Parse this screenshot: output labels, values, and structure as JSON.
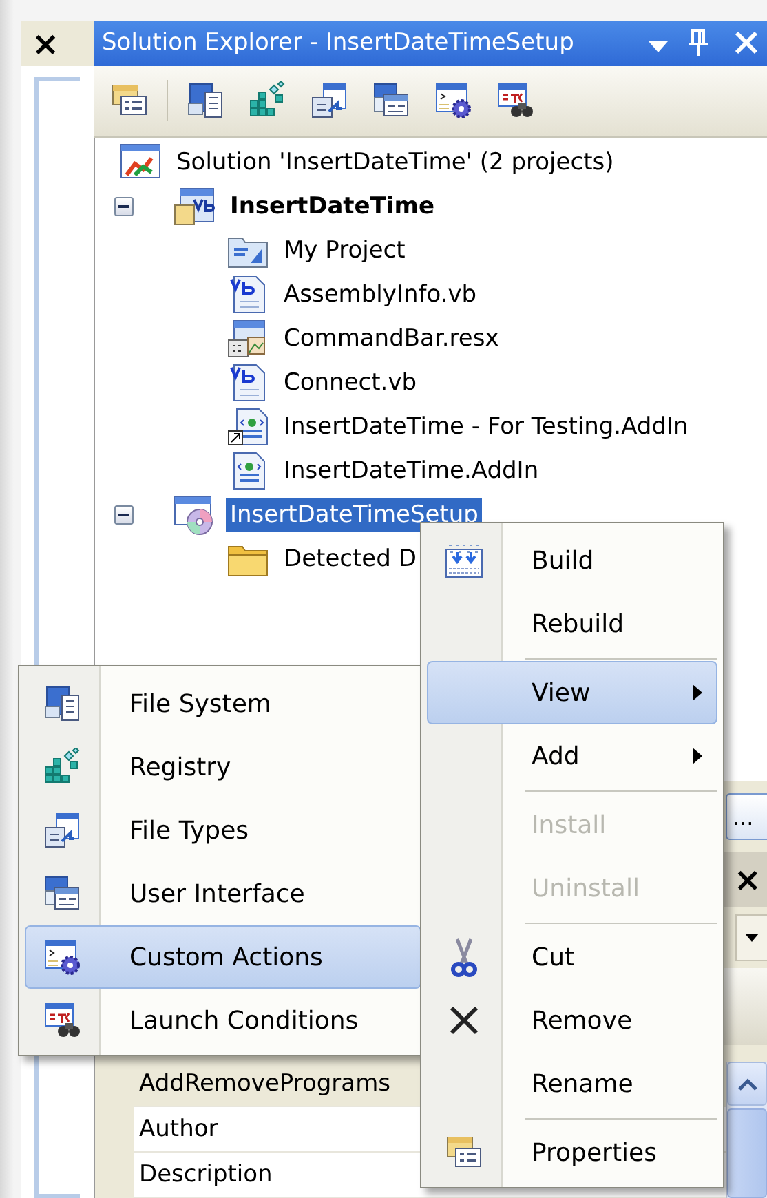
{
  "left_panel": {
    "close": "×"
  },
  "solution_explorer": {
    "title": "Solution Explorer - InsertDateTimeSetup",
    "tree": [
      {
        "label": "Solution 'InsertDateTime' (2 projects)",
        "kind": "solution",
        "selected": false,
        "emphasized": false,
        "children": [
          {
            "label": "InsertDateTime",
            "kind": "vbproject",
            "selected": false,
            "emphasized": true,
            "expanded": true,
            "children": [
              {
                "label": "My Project",
                "kind": "myproject",
                "selected": false,
                "emphasized": false
              },
              {
                "label": "AssemblyInfo.vb",
                "kind": "vbfile",
                "selected": false,
                "emphasized": false
              },
              {
                "label": "CommandBar.resx",
                "kind": "resx",
                "selected": false,
                "emphasized": false
              },
              {
                "label": "Connect.vb",
                "kind": "vbfile",
                "selected": false,
                "emphasized": false
              },
              {
                "label": "InsertDateTime - For Testing.AddIn",
                "kind": "addin-link",
                "selected": false,
                "emphasized": false
              },
              {
                "label": "InsertDateTime.AddIn",
                "kind": "addin",
                "selected": false,
                "emphasized": false
              }
            ]
          },
          {
            "label": "InsertDateTimeSetup",
            "kind": "setup",
            "selected": true,
            "emphasized": false,
            "expanded": true,
            "children": [
              {
                "label": "Detected D",
                "kind": "folder",
                "selected": false,
                "emphasized": false
              }
            ]
          }
        ]
      }
    ]
  },
  "properties": {
    "ellipsis_button": "...",
    "close": "×",
    "rows": [
      {
        "name": "AddRemovePrograms",
        "kind": "header"
      },
      {
        "name": "Author",
        "kind": "property"
      },
      {
        "name": "Description",
        "kind": "property"
      }
    ]
  },
  "context_menu": [
    {
      "kind": "item",
      "label": "Build",
      "selected": false,
      "disabled": false,
      "submenu": false
    },
    {
      "kind": "item",
      "label": "Rebuild",
      "selected": false,
      "disabled": false,
      "submenu": false
    },
    {
      "kind": "separator"
    },
    {
      "kind": "item",
      "label": "View",
      "selected": true,
      "disabled": false,
      "submenu": true
    },
    {
      "kind": "item",
      "label": "Add",
      "selected": false,
      "disabled": false,
      "submenu": true
    },
    {
      "kind": "separator"
    },
    {
      "kind": "item",
      "label": "Install",
      "selected": false,
      "disabled": true,
      "submenu": false
    },
    {
      "kind": "item",
      "label": "Uninstall",
      "selected": false,
      "disabled": true,
      "submenu": false
    },
    {
      "kind": "separator"
    },
    {
      "kind": "item",
      "label": "Cut",
      "selected": false,
      "disabled": false,
      "submenu": false
    },
    {
      "kind": "item",
      "label": "Remove",
      "selected": false,
      "disabled": false,
      "submenu": false
    },
    {
      "kind": "item",
      "label": "Rename",
      "selected": false,
      "disabled": false,
      "submenu": false
    },
    {
      "kind": "separator"
    },
    {
      "kind": "item",
      "label": "Properties",
      "selected": false,
      "disabled": false,
      "submenu": false
    }
  ],
  "view_submenu": [
    {
      "kind": "item",
      "label": "File System",
      "selected": false,
      "disabled": false,
      "submenu": false
    },
    {
      "kind": "item",
      "label": "Registry",
      "selected": false,
      "disabled": false,
      "submenu": false
    },
    {
      "kind": "item",
      "label": "File Types",
      "selected": false,
      "disabled": false,
      "submenu": false
    },
    {
      "kind": "item",
      "label": "User Interface",
      "selected": false,
      "disabled": false,
      "submenu": false
    },
    {
      "kind": "item",
      "label": "Custom Actions",
      "selected": true,
      "disabled": false,
      "submenu": false
    },
    {
      "kind": "item",
      "label": "Launch Conditions",
      "selected": false,
      "disabled": false,
      "submenu": false
    }
  ]
}
